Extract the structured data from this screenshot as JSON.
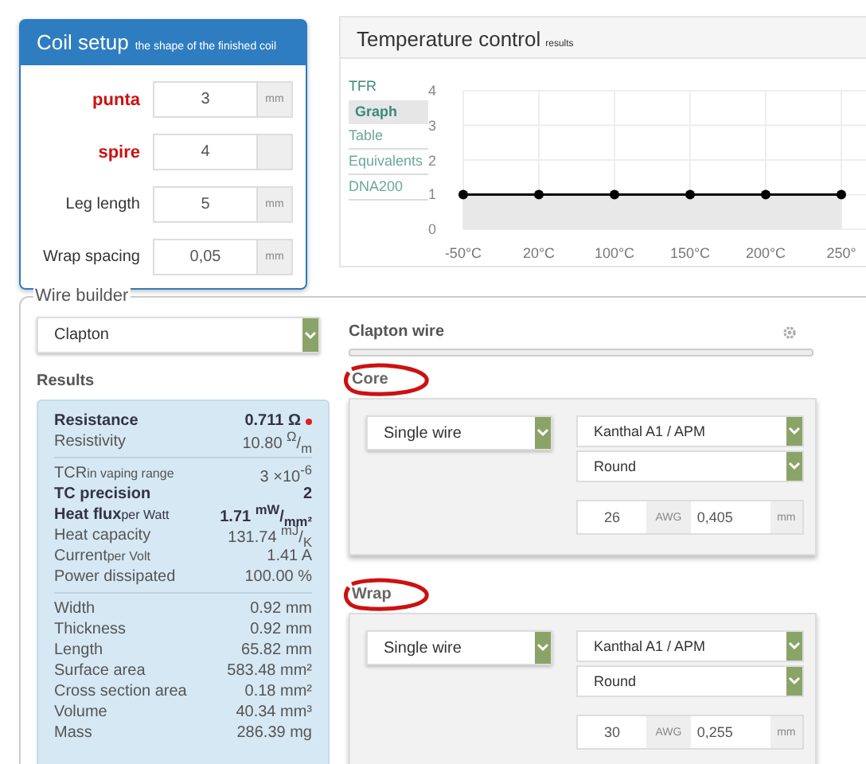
{
  "coil_setup": {
    "title": "Coil setup",
    "subtitle": "the shape of the finished coil",
    "fields": [
      {
        "label": "punta",
        "highlight": true,
        "value": "3",
        "unit": "mm"
      },
      {
        "label": "spire",
        "highlight": true,
        "value": "4"
      },
      {
        "label": "Leg length",
        "highlight": false,
        "value": "5",
        "unit": "mm"
      },
      {
        "label": "Wrap spacing",
        "highlight": false,
        "value": "0,05",
        "unit": "mm"
      }
    ]
  },
  "temperature_control": {
    "title": "Temperature control",
    "subtitle": "results",
    "menu_heading": "TFR",
    "tabs": [
      {
        "label": "Graph",
        "selected": true
      },
      {
        "label": "Table",
        "selected": false
      },
      {
        "label": "Equivalents",
        "selected": false
      },
      {
        "label": "DNA200",
        "selected": false
      }
    ],
    "chart_data": {
      "type": "line",
      "categories": [
        "-50°C",
        "20°C",
        "100°C",
        "150°C",
        "200°C",
        "250°"
      ],
      "series": [
        {
          "color": "#000000",
          "values": [
            1,
            1,
            1,
            1,
            1,
            1
          ],
          "marker": true
        }
      ],
      "ylim": [
        0,
        4
      ],
      "yticks": [
        0,
        1,
        2,
        3,
        4
      ],
      "grid": true
    }
  },
  "wire_builder": {
    "legend": "Wire builder",
    "wire_type": "Clapton",
    "results_title": "Results",
    "result_groups": [
      [
        {
          "label": "Resistance",
          "value": "0.711 Ω",
          "bold": true,
          "alert": true
        },
        {
          "label": "Resistivity",
          "value": "10.80 $^{Ω}$/$_{m}$",
          "bold": false,
          "alert": false
        }
      ],
      [
        {
          "label": "TCR",
          "note": "in vaping range",
          "value": "3 ×10$^{-6}$",
          "bold": false,
          "alert": false
        },
        {
          "label": "TC precision",
          "value": "2",
          "bold": true,
          "alert": false
        },
        {
          "label": "Heat flux",
          "note": "per Watt",
          "value": "1.71 $^{mW}$/$_{mm²}$",
          "bold": true,
          "alert": false
        },
        {
          "label": "Heat capacity",
          "value": "131.74 $^{mJ}$/$_{K}$",
          "bold": false,
          "alert": false
        },
        {
          "label": "Current",
          "note": "per Volt",
          "value": "1.41 A",
          "bold": false,
          "alert": false
        },
        {
          "label": "Power dissipated",
          "value": "100.00 %",
          "bold": false,
          "alert": false
        }
      ],
      [
        {
          "label": "Width",
          "value": "0.92 mm",
          "bold": false,
          "alert": false
        },
        {
          "label": "Thickness",
          "value": "0.92 mm",
          "bold": false,
          "alert": false
        },
        {
          "label": "Length",
          "value": "65.82 mm",
          "bold": false,
          "alert": false
        },
        {
          "label": "Surface area",
          "value": "583.48 mm²",
          "bold": false,
          "alert": false
        },
        {
          "label": "Cross section area",
          "value": "0.18 mm²",
          "bold": false,
          "alert": false
        },
        {
          "label": "Volume",
          "value": "40.34 mm³",
          "bold": false,
          "alert": false
        },
        {
          "label": "Mass",
          "value": "286.39 mg",
          "bold": false,
          "alert": false
        }
      ]
    ],
    "wire_title": "Clapton wire",
    "sections": [
      {
        "title": "Core",
        "circled": true,
        "type": "Single wire",
        "material": "Kanthal A1 / APM",
        "shape": "Round",
        "awg": "26",
        "awg_unit": "AWG",
        "diameter": "0,405",
        "diameter_unit": "mm"
      },
      {
        "title": "Wrap",
        "circled": true,
        "type": "Single wire",
        "material": "Kanthal A1 / APM",
        "shape": "Round",
        "awg": "30",
        "awg_unit": "AWG",
        "diameter": "0,255",
        "diameter_unit": "mm"
      }
    ]
  }
}
